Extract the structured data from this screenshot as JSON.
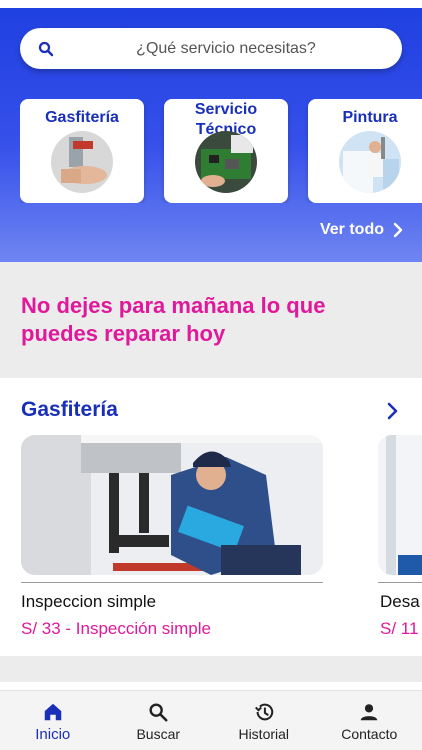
{
  "search": {
    "placeholder": "¿Qué servicio necesitas?",
    "icon": "search-icon"
  },
  "categories": [
    {
      "label_line1": "Gasfitería",
      "label_line2": "",
      "icon": "plumbing-photo"
    },
    {
      "label_line1": "Servicio",
      "label_line2": "Técnico",
      "icon": "electronics-repair-photo"
    },
    {
      "label_line1": "Pintura",
      "label_line2": "",
      "icon": "painter-photo"
    }
  ],
  "see_all": {
    "label": "Ver todo",
    "icon": "chevron-right-icon"
  },
  "promo": {
    "text": "No dejes para mañana lo que puedes reparar hoy"
  },
  "section": {
    "title": "Gasfitería",
    "arrow_icon": "chevron-right-icon",
    "cards": [
      {
        "name": "Inspeccion simple",
        "price": "S/ 33 - Inspección simple"
      },
      {
        "name": "Desa",
        "price": "S/ 11"
      }
    ]
  },
  "nav": {
    "items": [
      {
        "label": "Inicio",
        "icon": "home-icon"
      },
      {
        "label": "Buscar",
        "icon": "search-icon"
      },
      {
        "label": "Historial",
        "icon": "history-icon"
      },
      {
        "label": "Contacto",
        "icon": "person-icon"
      }
    ]
  },
  "colors": {
    "primary": "#1a2fb8",
    "accent": "#e0199a",
    "hero_top": "#1e3fe0",
    "hero_bottom": "#6f85f2"
  }
}
